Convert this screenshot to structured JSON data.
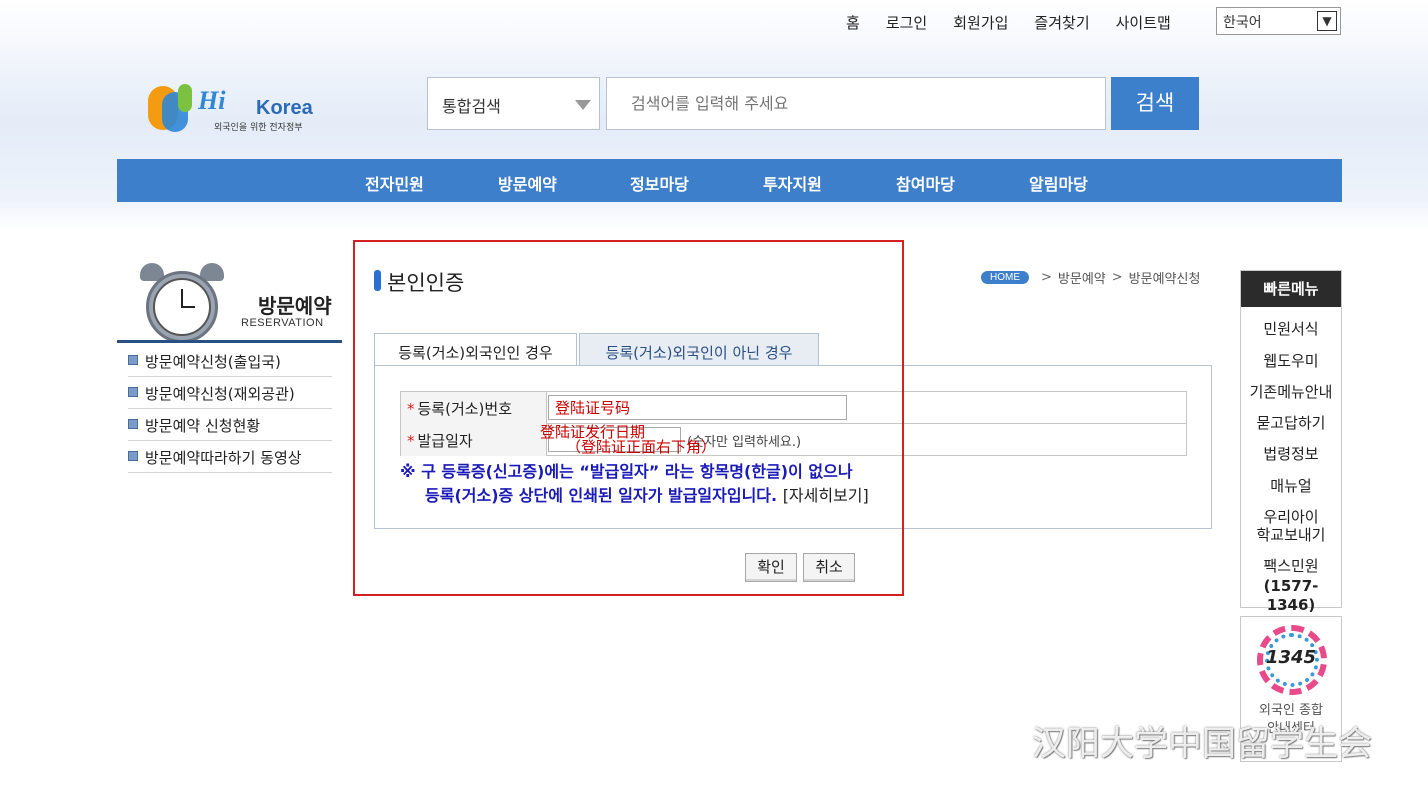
{
  "top_links": [
    "홈",
    "로그인",
    "회원가입",
    "즐겨찾기",
    "사이트맵"
  ],
  "language": {
    "selected": "한국어",
    "arrow": "⌄"
  },
  "logo": {
    "hi": "Hi",
    "korea": "Korea",
    "tagline": "외국인을 위한 전자정부"
  },
  "search": {
    "scope": "통합검색",
    "placeholder": "검색어를 입력해 주세요",
    "button": "검색"
  },
  "nav": [
    "전자민원",
    "방문예약",
    "정보마당",
    "투자지원",
    "참여마당",
    "알림마당"
  ],
  "sidebar": {
    "title": "방문예약",
    "subtitle": "RESERVATION",
    "items": [
      "방문예약신청(출입국)",
      "방문예약신청(재외공관)",
      "방문예약 신청현황",
      "방문예약따라하기 동영상"
    ]
  },
  "page": {
    "heading": "본인인증",
    "breadcrumb": [
      "HOME",
      "방문예약",
      "방문예약신청"
    ],
    "breadcrumb_sep": ">"
  },
  "tabs": [
    "등록(거소)외국인인 경우",
    "등록(거소)외국인이 아닌 경우"
  ],
  "form": {
    "required_mark": "*",
    "reg_label": "등록(거소)번호",
    "reg_value": "登陆证号码",
    "date_label": "발급일자",
    "date_value": "",
    "date_hint": "(숫자만 입력하세요.)",
    "overlay_line1": "登陆证发行日期",
    "overlay_line2": "（登陆证正面右下角）"
  },
  "notice": {
    "line1": "※ 구 등록증(신고증)에는 “발급일자” 라는 항목명(한글)이 없으나",
    "line2": "등록(거소)증 상단에 인쇄된 일자가 발급일자입니다.",
    "more": "[자세히보기]"
  },
  "buttons": {
    "confirm": "확인",
    "cancel": "취소"
  },
  "quick_menu": {
    "title": "빠른메뉴",
    "items": [
      "민원서식",
      "웹도우미",
      "기존메뉴안내",
      "묻고답하기",
      "법령정보",
      "매뉴얼",
      "우리아이",
      "학교보내기",
      "팩스민원",
      "(1577-1346)"
    ]
  },
  "center": {
    "number": "1345",
    "line1": "외국인 종합",
    "line2": "안내센터"
  },
  "watermark": "汉阳大学中国留学生会",
  "colors": {
    "nav": "#3d7fcb",
    "highlight_box": "#d42020",
    "notice": "#1a1ab8"
  }
}
